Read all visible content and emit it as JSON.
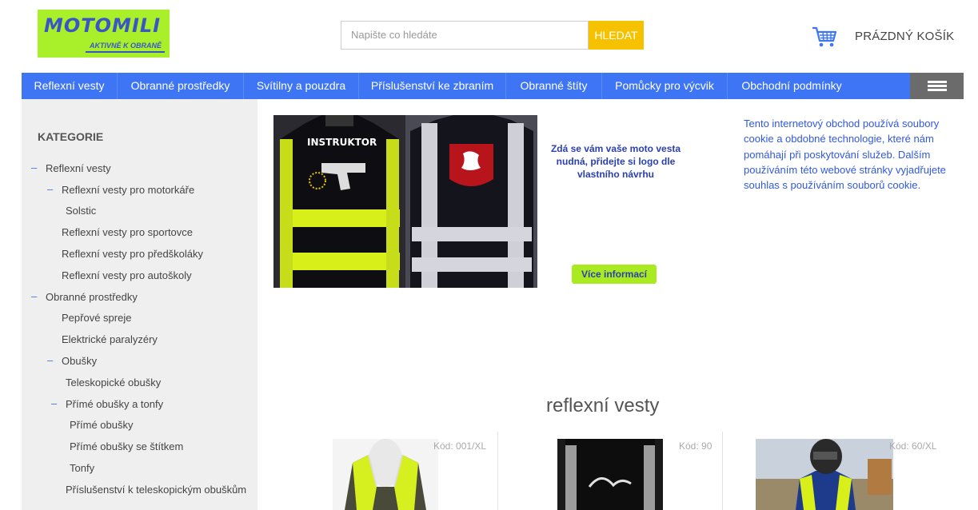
{
  "header": {
    "logo_main": "MOTOMILI",
    "logo_sub": "AKTIVNĚ K OBRANĚ",
    "search_placeholder": "Napište co hledáte",
    "search_button": "HLEDAT",
    "cart_label": "PRÁZDNÝ KOŠÍK"
  },
  "nav": {
    "items": [
      "Reflexní vesty",
      "Obranné prostředky",
      "Svítilny a pouzdra",
      "Příslušenství ke zbraním",
      "Obranné štíty",
      "Pomůcky pro výcvik",
      "Obchodní podmínky"
    ]
  },
  "sidebar": {
    "title": "KATEGORIE",
    "items": [
      "Reflexní vesty",
      "Reflexní vesty pro motorkáře",
      "Solstic",
      "Reflexní vesty pro sportovce",
      "Reflexní vesty pro předškoláky",
      "Reflexní vesty pro autoškoly",
      "Obranné prostředky",
      "Pepřové spreje",
      "Elektrické paralyzéry",
      "Obušky",
      "Teleskopické obušky",
      "Přímé obušky a tonfy",
      "Přímé obušky",
      "Přímé obušky se štítkem",
      "Tonfy",
      "Příslušenství k teleskopickým obuškům"
    ],
    "dash": "–"
  },
  "banner": {
    "vest_text": "INSTRUKTOR",
    "promo_text": "Zdá se vám vaše moto vesta nudná, přidejte si logo dle vlastního návrhu",
    "more_button": "Více informací"
  },
  "cookie_notice": "Tento internetový obchod používá soubory cookie a obdobné technologie, které nám pomáhají při poskytování služeb. Dalším používáním této webové stránky vyjadřujete souhlas s používáním souborů cookie.",
  "main": {
    "section_title": "reflexní vesty",
    "products": [
      {
        "code": "Kód: 001/XL"
      },
      {
        "code": "Kód: 90"
      },
      {
        "code": "Kód: 60/XL"
      }
    ]
  },
  "colors": {
    "nav_blue": "#3d75f5",
    "logo_green": "#aaf02a",
    "search_button": "#f6c200",
    "cookie_text": "#3158e0"
  }
}
